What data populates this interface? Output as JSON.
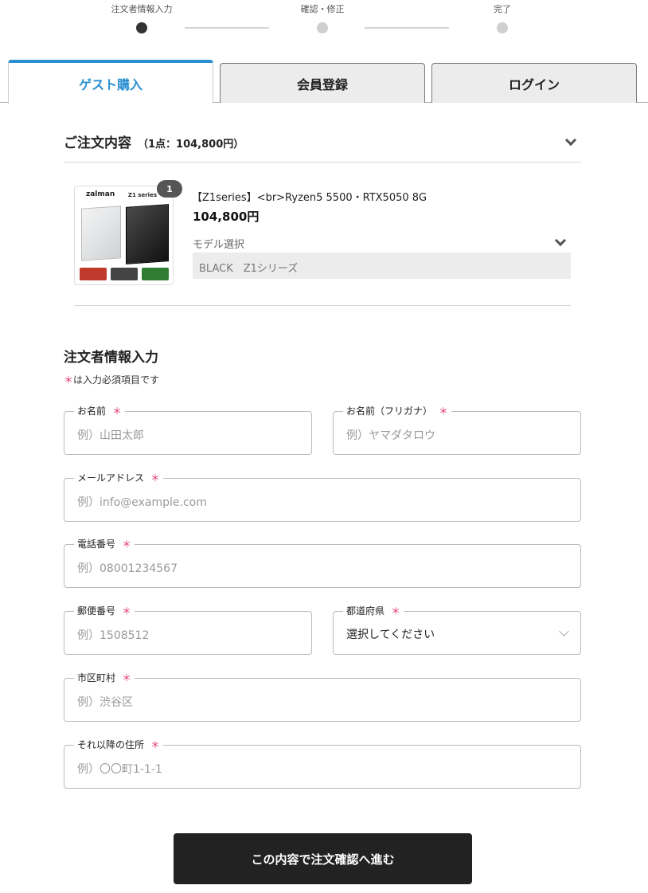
{
  "stepper": {
    "steps": [
      {
        "label": "注文者情報入力",
        "active": true
      },
      {
        "label": "確認・修正",
        "active": false
      },
      {
        "label": "完了",
        "active": false
      }
    ]
  },
  "tabs": [
    {
      "label": "ゲスト購入",
      "active": true
    },
    {
      "label": "会員登録",
      "active": false
    },
    {
      "label": "ログイン",
      "active": false
    }
  ],
  "order": {
    "title": "ご注文内容",
    "summary": "（1点：104,800円）",
    "product": {
      "image_brand": "zalman",
      "image_series": "Z1 series",
      "quantity": "1",
      "name": "【Z1series】<br>Ryzen5 5500・RTX5050 8G",
      "price": "104,800円",
      "model_label": "モデル選択",
      "model_value": "BLACK　Z1シリーズ"
    }
  },
  "form": {
    "title": "注文者情報入力",
    "required_mark": "＊",
    "required_note": "は入力必須項目です",
    "fields": {
      "name": {
        "label": "お名前",
        "placeholder": "例）山田太郎"
      },
      "kana": {
        "label": "お名前（フリガナ）",
        "placeholder": "例）ヤマダタロウ"
      },
      "email": {
        "label": "メールアドレス",
        "placeholder": "例）info@example.com"
      },
      "phone": {
        "label": "電話番号",
        "placeholder": "例）08001234567"
      },
      "zip": {
        "label": "郵便番号",
        "placeholder": "例）1508512"
      },
      "prefecture": {
        "label": "都道府県",
        "value": "選択してください"
      },
      "city": {
        "label": "市区町村",
        "placeholder": "例）渋谷区"
      },
      "address": {
        "label": "それ以降の住所",
        "placeholder": "例）〇〇町1-1-1"
      }
    },
    "submit_label": "この内容で注文確認へ進む"
  },
  "colors": {
    "accent": "#2a8fd0",
    "required": "#e2306c",
    "button_bg": "#222222"
  }
}
